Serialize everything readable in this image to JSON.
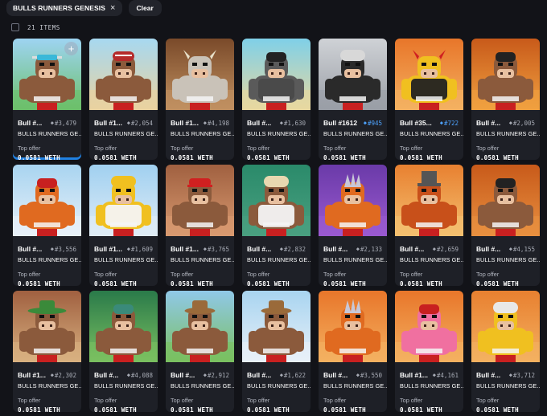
{
  "filters": {
    "chip_label": "BULLS RUNNERS GENESIS",
    "chip_close": "×",
    "clear_label": "Clear"
  },
  "results": {
    "count_label": "21 ITEMS"
  },
  "add_button_label": "+",
  "items": [
    {
      "name": "Bull #...",
      "rank": "#3,479",
      "collection": "BULLS RUNNERS GE...",
      "offer_label": "Top offer",
      "price": "0.0581 WETH",
      "rank_color": "gray",
      "bg": [
        "#9ed4f2",
        "#6cc06a"
      ],
      "skin": "#8b5a3c",
      "hat": "#3ab8d8",
      "hatType": "visor",
      "shirt": "none",
      "selected": true,
      "add_button": true
    },
    {
      "name": "Bull #1...",
      "rank": "#2,054",
      "collection": "BULLS RUNNERS GE...",
      "offer_label": "Top offer",
      "price": "0.0581 WETH",
      "rank_color": "gray",
      "bg": [
        "#a7d8f0",
        "#e9d2a0"
      ],
      "skin": "#8b5a3c",
      "hat": "#b52a2a",
      "hatType": "helmet",
      "shirt": "none"
    },
    {
      "name": "Bull #1...",
      "rank": "#4,198",
      "collection": "BULLS RUNNERS GE...",
      "offer_label": "Top offer",
      "price": "0.0581 WETH",
      "rank_color": "gray",
      "bg": [
        "#7a4a2a",
        "#c09060"
      ],
      "skin": "#c9c2b8",
      "hat": "none",
      "hatType": "horns",
      "shirt": "none"
    },
    {
      "name": "Bull #...",
      "rank": "#1,630",
      "collection": "BULLS RUNNERS GE...",
      "offer_label": "Top offer",
      "price": "0.0581 WETH",
      "rank_color": "gray",
      "bg": [
        "#7fd0e8",
        "#e8d8a0"
      ],
      "skin": "#5a5a5a",
      "hat": "#222",
      "hatType": "beanie",
      "shirt": "#4a4a4a"
    },
    {
      "name": "Bull #1612",
      "rank": "#945",
      "collection": "BULLS RUNNERS GE...",
      "offer_label": "Top offer",
      "price": "0.0581 WETH",
      "rank_color": "blue",
      "bg": [
        "#cfd2d6",
        "#9a9ea6"
      ],
      "skin": "#2a2a2a",
      "hat": "#d8d8d8",
      "hatType": "hair",
      "shirt": "none"
    },
    {
      "name": "Bull #35...",
      "rank": "#722",
      "collection": "BULLS RUNNERS GE...",
      "offer_label": "Top offer",
      "price": "0.0581 WETH",
      "rank_color": "blue",
      "bg": [
        "#e8762a",
        "#f4b060"
      ],
      "skin": "#f0c020",
      "hat": "#d02020",
      "hatType": "horns",
      "shirt": "#222"
    },
    {
      "name": "Bull #...",
      "rank": "#2,005",
      "collection": "BULLS RUNNERS GE...",
      "offer_label": "Top offer",
      "price": "0.0581 WETH",
      "rank_color": "gray",
      "bg": [
        "#c85a1a",
        "#f0a040"
      ],
      "skin": "#8b5a3c",
      "hat": "#222",
      "hatType": "beanie",
      "shirt": "none"
    },
    {
      "name": "Bull #...",
      "rank": "#3,556",
      "collection": "BULLS RUNNERS GE...",
      "offer_label": "Top offer",
      "price": "0.0581 WETH",
      "rank_color": "gray",
      "bg": [
        "#a8d4f0",
        "#e8f0f8"
      ],
      "skin": "#e06a20",
      "hat": "#c82020",
      "hatType": "beanie",
      "shirt": "none"
    },
    {
      "name": "Bull #1...",
      "rank": "#1,609",
      "collection": "BULLS RUNNERS GE...",
      "offer_label": "Top offer",
      "price": "0.0581 WETH",
      "rank_color": "gray",
      "bg": [
        "#a0d0f0",
        "#e0ecf6"
      ],
      "skin": "#f0c020",
      "hat": "#f0c020",
      "hatType": "hair",
      "shirt": "#f4f4f4"
    },
    {
      "name": "Bull #1...",
      "rank": "#3,765",
      "collection": "BULLS RUNNERS GE...",
      "offer_label": "Top offer",
      "price": "0.0581 WETH",
      "rank_color": "gray",
      "bg": [
        "#a06040",
        "#d89a70"
      ],
      "skin": "#8b5a3c",
      "hat": "#d02020",
      "hatType": "cap",
      "shirt": "none"
    },
    {
      "name": "Bull #...",
      "rank": "#2,832",
      "collection": "BULLS RUNNERS GE...",
      "offer_label": "Top offer",
      "price": "0.0581 WETH",
      "rank_color": "gray",
      "bg": [
        "#2a8a6a",
        "#4aa080"
      ],
      "skin": "#8b5a3c",
      "hat": "#e8d8b0",
      "hatType": "hair",
      "shirt": "#f4f4f4"
    },
    {
      "name": "Bull #...",
      "rank": "#2,133",
      "collection": "BULLS RUNNERS GE...",
      "offer_label": "Top offer",
      "price": "0.0581 WETH",
      "rank_color": "gray",
      "bg": [
        "#6a3aa8",
        "#9a5ad0"
      ],
      "skin": "#e06a20",
      "hat": "#c8c8d8",
      "hatType": "mohawk",
      "shirt": "none"
    },
    {
      "name": "Bull #...",
      "rank": "#2,659",
      "collection": "BULLS RUNNERS GE...",
      "offer_label": "Top offer",
      "price": "0.0581 WETH",
      "rank_color": "gray",
      "bg": [
        "#e88030",
        "#f4c070"
      ],
      "skin": "#c8501a",
      "hat": "#555",
      "hatType": "tophat",
      "shirt": "none"
    },
    {
      "name": "Bull #...",
      "rank": "#4,155",
      "collection": "BULLS RUNNERS GE...",
      "offer_label": "Top offer",
      "price": "0.0581 WETH",
      "rank_color": "gray",
      "bg": [
        "#c85a1a",
        "#e89040"
      ],
      "skin": "#8b5a3c",
      "hat": "#222",
      "hatType": "beanie",
      "shirt": "none"
    },
    {
      "name": "Bull #1...",
      "rank": "#2,302",
      "collection": "BULLS RUNNERS GE...",
      "offer_label": "Top offer",
      "price": "0.0581 WETH",
      "rank_color": "gray",
      "bg": [
        "#a06040",
        "#d8b080"
      ],
      "skin": "#8b5a3c",
      "hat": "#3a8a3a",
      "hatType": "sombrero",
      "shirt": "none"
    },
    {
      "name": "Bull #...",
      "rank": "#4,088",
      "collection": "BULLS RUNNERS GE...",
      "offer_label": "Top offer",
      "price": "0.0581 WETH",
      "rank_color": "gray",
      "bg": [
        "#2a7a4a",
        "#7ac060"
      ],
      "skin": "#8b5a3c",
      "hat": "#3a8a7a",
      "hatType": "beanie",
      "shirt": "none"
    },
    {
      "name": "Bull #...",
      "rank": "#2,912",
      "collection": "BULLS RUNNERS GE...",
      "offer_label": "Top offer",
      "price": "0.0581 WETH",
      "rank_color": "gray",
      "bg": [
        "#90c8e8",
        "#7ac060"
      ],
      "skin": "#8b5a3c",
      "hat": "#9a6a3a",
      "hatType": "cowboy",
      "shirt": "none"
    },
    {
      "name": "Bull #...",
      "rank": "#1,622",
      "collection": "BULLS RUNNERS GE...",
      "offer_label": "Top offer",
      "price": "0.0581 WETH",
      "rank_color": "gray",
      "bg": [
        "#a8d4f0",
        "#e8f0f8"
      ],
      "skin": "#8b5a3c",
      "hat": "#9a6a3a",
      "hatType": "cowboy",
      "shirt": "none"
    },
    {
      "name": "Bull #...",
      "rank": "#3,550",
      "collection": "BULLS RUNNERS GE...",
      "offer_label": "Top offer",
      "price": "0.0581 WETH",
      "rank_color": "gray",
      "bg": [
        "#e8762a",
        "#f4b060"
      ],
      "skin": "#e06a20",
      "hat": "#c8c8d8",
      "hatType": "mohawk",
      "shirt": "none"
    },
    {
      "name": "Bull #1...",
      "rank": "#4,161",
      "collection": "BULLS RUNNERS GE...",
      "offer_label": "Top offer",
      "price": "0.0581 WETH",
      "rank_color": "gray",
      "bg": [
        "#e8762a",
        "#f4b060"
      ],
      "skin": "#f070a0",
      "hat": "#c82020",
      "hatType": "beanie",
      "shirt": "none"
    },
    {
      "name": "Bull #...",
      "rank": "#3,712",
      "collection": "BULLS RUNNERS GE...",
      "offer_label": "Top offer",
      "price": "0.0581 WETH",
      "rank_color": "gray",
      "bg": [
        "#e88030",
        "#f4b060"
      ],
      "skin": "#f0c020",
      "hat": "#e8e8e8",
      "hatType": "hair",
      "shirt": "none"
    }
  ]
}
